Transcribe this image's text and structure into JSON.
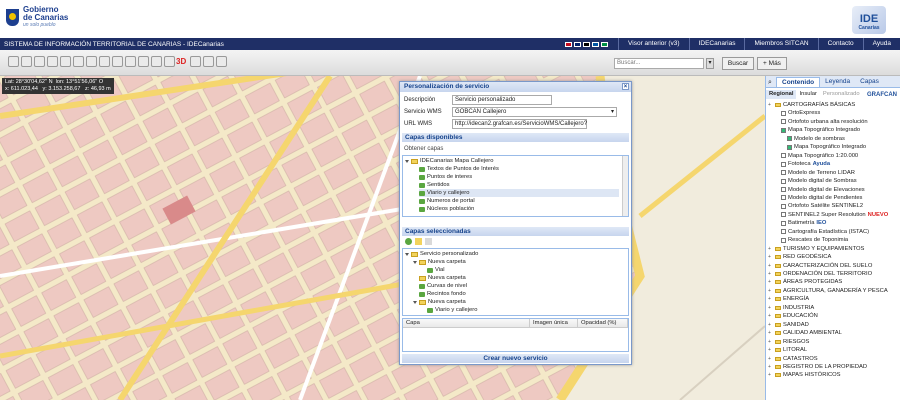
{
  "header": {
    "gov_line1": "Gobierno",
    "gov_line2": "de Canarias",
    "gov_tag": "un solo pueblo",
    "ide_logo": "IDE",
    "ide_sub": "Canarias"
  },
  "nav": {
    "title": "SISTEMA DE INFORMACIÓN TERRITORIAL DE CANARIAS - IDECanarias",
    "items": [
      "Visor anterior (v3)",
      "IDECanarias",
      "Miembros SITCAN",
      "Contacto",
      "Ayuda"
    ]
  },
  "toolbar": {
    "search_placeholder": "Buscar...",
    "search_button": "Buscar",
    "more_button": "+ Más",
    "tool_3d": "3D"
  },
  "map": {
    "coords_line1": "Lat: 28°30'04,62'' N  lon: 13°51'56,06'' O",
    "coords_line2": "x: 611.023,44   y: 3.153.258,67   z: 46,93 m"
  },
  "dialog": {
    "title": "Personalización de servicio",
    "fields": [
      {
        "label": "Descripción",
        "value": "Servicio personalizado"
      },
      {
        "label": "Servicio WMS",
        "value": "GOBCAN Callejero"
      },
      {
        "label": "URL WMS",
        "value": "http://idecan2.grafcan.es/ServicioWMS/Callejero?"
      }
    ],
    "available_title": "Capas disponibles",
    "obtain_label": "Obtener capas",
    "available": [
      {
        "text": "IDECanarias Mapa Callejero",
        "type": "folder"
      },
      {
        "text": "Textos de Puntos de Interés",
        "type": "layer"
      },
      {
        "text": "Puntos de interes",
        "type": "layer"
      },
      {
        "text": "Sentidos",
        "type": "layer"
      },
      {
        "text": "Viario y callejero",
        "type": "layer"
      },
      {
        "text": "Numeros de portal",
        "type": "layer"
      },
      {
        "text": "Núcleos población",
        "type": "layer"
      }
    ],
    "selected_title": "Capas seleccionadas",
    "selected": [
      {
        "text": "Servicio personalizado",
        "type": "folder"
      },
      {
        "text": "Nueva carpeta",
        "type": "folder"
      },
      {
        "text": "Vial",
        "type": "layer"
      },
      {
        "text": "Nueva carpeta",
        "type": "folder"
      },
      {
        "text": "Curvas de nivel",
        "type": "layer"
      },
      {
        "text": "Recintos fondo",
        "type": "layer"
      },
      {
        "text": "Nueva carpeta",
        "type": "folder"
      },
      {
        "text": "Viario y callejero",
        "type": "layer"
      }
    ],
    "grid_cols": [
      "Capa",
      "Imagen única",
      "Opacidad (%)"
    ],
    "create_button": "Crear nuevo servicio"
  },
  "panel": {
    "tabs": [
      "Contenido",
      "Leyenda",
      "Capas"
    ],
    "subtabs": [
      "Regional",
      "Insular",
      "Personalizado"
    ],
    "items": [
      {
        "text": "CARTOGRAFÍAS BÁSICAS",
        "kind": "folder",
        "indent": 0
      },
      {
        "text": "OrtoExpress",
        "kind": "layer",
        "indent": 1,
        "checked": false
      },
      {
        "text": "Ortofoto urbana alta resolución",
        "kind": "layer",
        "indent": 1,
        "checked": false
      },
      {
        "text": "Mapa Topográfico Integrado",
        "kind": "layer",
        "indent": 1,
        "checked": true
      },
      {
        "text": "Modelo de sombras",
        "kind": "layer",
        "indent": 2,
        "checked": true
      },
      {
        "text": "Mapa Topográfico Integrado",
        "kind": "layer",
        "indent": 2,
        "checked": true
      },
      {
        "text": "Mapa Topográfico 1:20.000",
        "kind": "layer",
        "indent": 1,
        "checked": false
      },
      {
        "text": "Fototeca",
        "kind": "layer",
        "indent": 1,
        "checked": false,
        "extra": "Ayuda"
      },
      {
        "text": "Modelo de Terreno LIDAR",
        "kind": "layer",
        "indent": 1,
        "checked": false
      },
      {
        "text": "Modelo digital de Sombras",
        "kind": "layer",
        "indent": 1,
        "checked": false
      },
      {
        "text": "Modelo digital de Elevaciones",
        "kind": "layer",
        "indent": 1,
        "checked": false
      },
      {
        "text": "Modelo digital de Pendientes",
        "kind": "layer",
        "indent": 1,
        "checked": false
      },
      {
        "text": "Ortofoto Satélite SENTINEL2",
        "kind": "layer",
        "indent": 1,
        "checked": false
      },
      {
        "text": "SENTINEL2 Super Resolution",
        "kind": "layer",
        "indent": 1,
        "checked": false,
        "extra": "NUEVO"
      },
      {
        "text": "Batimetría",
        "kind": "layer",
        "indent": 1,
        "checked": false,
        "extra": "IEO"
      },
      {
        "text": "Cartografía Estadística (ISTAC)",
        "kind": "layer",
        "indent": 1,
        "checked": false
      },
      {
        "text": "Rescates de Toponimia",
        "kind": "layer",
        "indent": 1,
        "checked": false
      },
      {
        "text": "TURISMO Y EQUIPAMIENTOS",
        "kind": "folder",
        "indent": 0
      },
      {
        "text": "RED GEODÉSICA",
        "kind": "folder",
        "indent": 0
      },
      {
        "text": "CARACTERIZACIÓN DEL SUELO",
        "kind": "folder",
        "indent": 0
      },
      {
        "text": "ORDENACIÓN DEL TERRITORIO",
        "kind": "folder",
        "indent": 0
      },
      {
        "text": "ÁREAS PROTEGIDAS",
        "kind": "folder",
        "indent": 0
      },
      {
        "text": "AGRICULTURA, GANADERÍA Y PESCA",
        "kind": "folder",
        "indent": 0
      },
      {
        "text": "ENERGÍA",
        "kind": "folder",
        "indent": 0
      },
      {
        "text": "INDUSTRIA",
        "kind": "folder",
        "indent": 0
      },
      {
        "text": "EDUCACIÓN",
        "kind": "folder",
        "indent": 0
      },
      {
        "text": "SANIDAD",
        "kind": "folder",
        "indent": 0
      },
      {
        "text": "CALIDAD AMBIENTAL",
        "kind": "folder",
        "indent": 0
      },
      {
        "text": "RIESGOS",
        "kind": "folder",
        "indent": 0
      },
      {
        "text": "LITORAL",
        "kind": "folder",
        "indent": 0
      },
      {
        "text": "CATASTROS",
        "kind": "folder",
        "indent": 0
      },
      {
        "text": "REGISTRO DE LA PROPIEDAD",
        "kind": "folder",
        "indent": 0
      },
      {
        "text": "MAPAS HISTÓRICOS",
        "kind": "folder",
        "indent": 0
      }
    ],
    "grafcan": "GRAFCAN"
  }
}
